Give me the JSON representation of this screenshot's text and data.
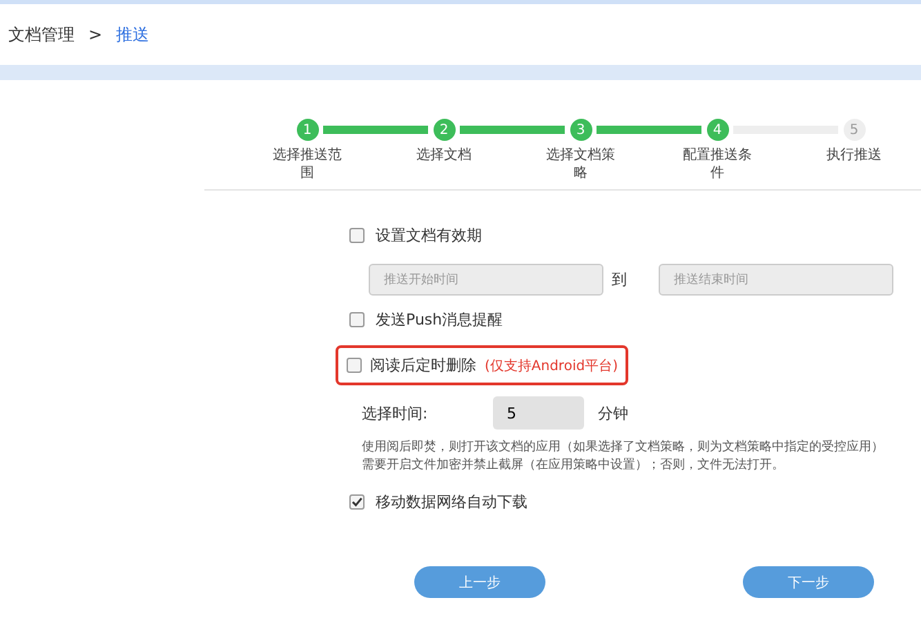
{
  "breadcrumb": {
    "parent": "文档管理",
    "separator": ">",
    "current": "推送"
  },
  "steps": [
    {
      "number": "1",
      "label": "选择推送范围",
      "done": true
    },
    {
      "number": "2",
      "label": "选择文档",
      "done": true
    },
    {
      "number": "3",
      "label": "选择文档策略",
      "done": true
    },
    {
      "number": "4",
      "label": "配置推送条件",
      "done": true
    },
    {
      "number": "5",
      "label": "执行推送",
      "done": false
    }
  ],
  "validity": {
    "label": "设置文档有效期",
    "checked": false,
    "start_placeholder": "推送开始时间",
    "to": "到",
    "end_placeholder": "推送结束时间"
  },
  "push": {
    "label": "发送Push消息提醒",
    "checked": false
  },
  "burn": {
    "label": "阅读后定时删除",
    "note": "(仅支持Android平台)",
    "checked": false,
    "highlighted": true,
    "time_label": "选择时间:",
    "time_value": "5",
    "unit": "分钟",
    "description": "使用阅后即焚，则打开该文档的应用（如果选择了文档策略，则为文档策略中指定的受控应用）需要开启文件加密并禁止截屏（在应用策略中设置）；否则，文件无法打开。"
  },
  "mobile_download": {
    "label": "移动数据网络自动下载",
    "checked": true
  },
  "buttons": {
    "prev": "上一步",
    "next": "下一步"
  }
}
